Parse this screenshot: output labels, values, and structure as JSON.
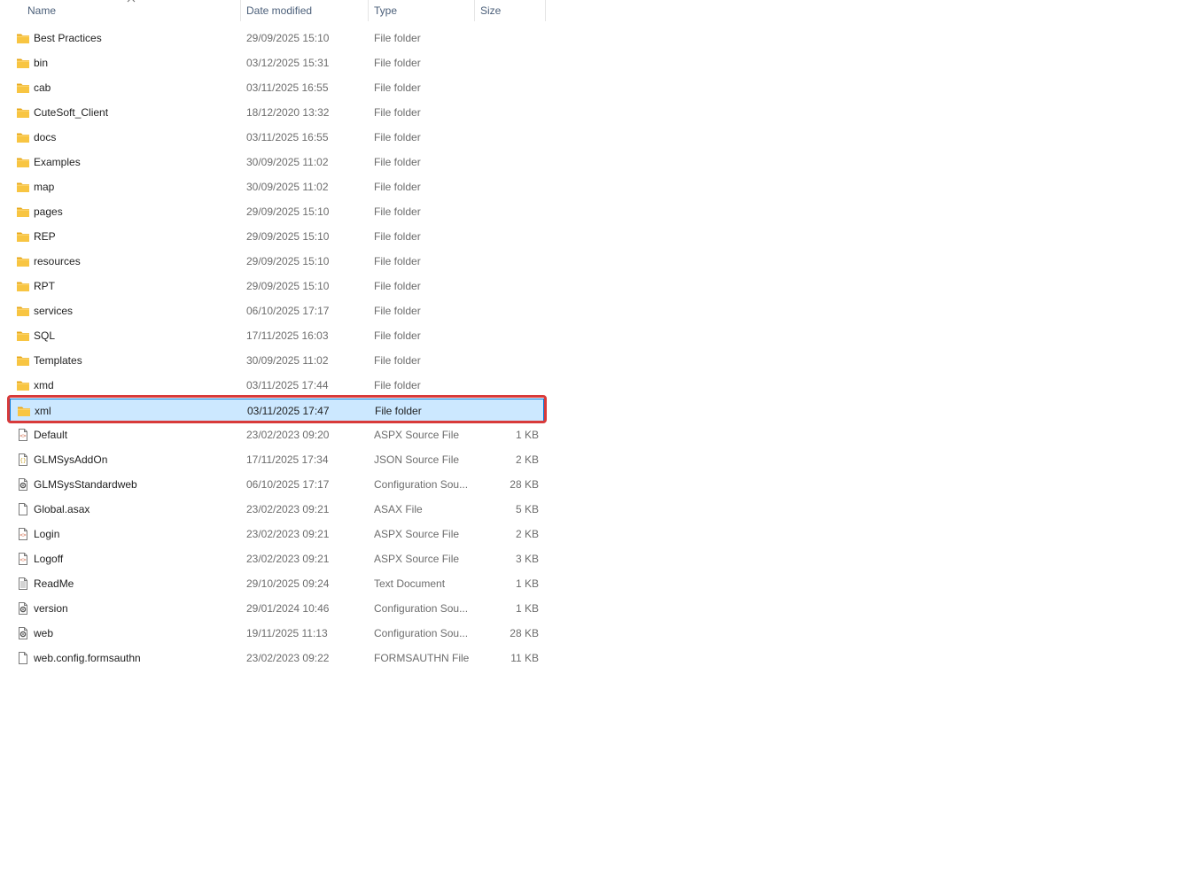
{
  "columns": {
    "name": "Name",
    "date_modified": "Date modified",
    "type": "Type",
    "size": "Size"
  },
  "sort": {
    "column": "name",
    "direction": "ascending"
  },
  "rows": [
    {
      "name": "Best Practices",
      "date": "29/09/2025 15:10",
      "type": "File folder",
      "size": "",
      "icon": "folder-icon"
    },
    {
      "name": "bin",
      "date": "03/12/2025 15:31",
      "type": "File folder",
      "size": "",
      "icon": "folder-icon"
    },
    {
      "name": "cab",
      "date": "03/11/2025 16:55",
      "type": "File folder",
      "size": "",
      "icon": "folder-icon"
    },
    {
      "name": "CuteSoft_Client",
      "date": "18/12/2020 13:32",
      "type": "File folder",
      "size": "",
      "icon": "folder-icon"
    },
    {
      "name": "docs",
      "date": "03/11/2025 16:55",
      "type": "File folder",
      "size": "",
      "icon": "folder-icon"
    },
    {
      "name": "Examples",
      "date": "30/09/2025 11:02",
      "type": "File folder",
      "size": "",
      "icon": "folder-icon"
    },
    {
      "name": "map",
      "date": "30/09/2025 11:02",
      "type": "File folder",
      "size": "",
      "icon": "folder-icon"
    },
    {
      "name": "pages",
      "date": "29/09/2025 15:10",
      "type": "File folder",
      "size": "",
      "icon": "folder-icon"
    },
    {
      "name": "REP",
      "date": "29/09/2025 15:10",
      "type": "File folder",
      "size": "",
      "icon": "folder-icon"
    },
    {
      "name": "resources",
      "date": "29/09/2025 15:10",
      "type": "File folder",
      "size": "",
      "icon": "folder-icon"
    },
    {
      "name": "RPT",
      "date": "29/09/2025 15:10",
      "type": "File folder",
      "size": "",
      "icon": "folder-icon"
    },
    {
      "name": "services",
      "date": "06/10/2025 17:17",
      "type": "File folder",
      "size": "",
      "icon": "folder-icon"
    },
    {
      "name": "SQL",
      "date": "17/11/2025 16:03",
      "type": "File folder",
      "size": "",
      "icon": "folder-icon"
    },
    {
      "name": "Templates",
      "date": "30/09/2025 11:02",
      "type": "File folder",
      "size": "",
      "icon": "folder-icon"
    },
    {
      "name": "xmd",
      "date": "03/11/2025 17:44",
      "type": "File folder",
      "size": "",
      "icon": "folder-icon"
    },
    {
      "name": "xml",
      "date": "03/11/2025 17:47",
      "type": "File folder",
      "size": "",
      "icon": "folder-icon",
      "selected": true
    },
    {
      "name": "Default",
      "date": "23/02/2023 09:20",
      "type": "ASPX Source File",
      "size": "1 KB",
      "icon": "aspx-file-icon"
    },
    {
      "name": "GLMSysAddOn",
      "date": "17/11/2025 17:34",
      "type": "JSON Source File",
      "size": "2 KB",
      "icon": "json-file-icon"
    },
    {
      "name": "GLMSysStandardweb",
      "date": "06/10/2025 17:17",
      "type": "Configuration Sou...",
      "size": "28 KB",
      "icon": "config-file-icon"
    },
    {
      "name": "Global.asax",
      "date": "23/02/2023 09:21",
      "type": "ASAX File",
      "size": "5 KB",
      "icon": "blank-file-icon"
    },
    {
      "name": "Login",
      "date": "23/02/2023 09:21",
      "type": "ASPX Source File",
      "size": "2 KB",
      "icon": "aspx-file-icon"
    },
    {
      "name": "Logoff",
      "date": "23/02/2023 09:21",
      "type": "ASPX Source File",
      "size": "3 KB",
      "icon": "aspx-file-icon"
    },
    {
      "name": "ReadMe",
      "date": "29/10/2025 09:24",
      "type": "Text Document",
      "size": "1 KB",
      "icon": "text-file-icon"
    },
    {
      "name": "version",
      "date": "29/01/2024 10:46",
      "type": "Configuration Sou...",
      "size": "1 KB",
      "icon": "config-file-icon"
    },
    {
      "name": "web",
      "date": "19/11/2025 11:13",
      "type": "Configuration Sou...",
      "size": "28 KB",
      "icon": "config-file-icon"
    },
    {
      "name": "web.config.formsauthn",
      "date": "23/02/2023 09:22",
      "type": "FORMSAUTHN File",
      "size": "11 KB",
      "icon": "blank-file-icon"
    }
  ],
  "colors": {
    "header_text": "#4c607a",
    "selection_fill": "#cce8ff",
    "selection_border": "#0078d7",
    "highlight_outline": "#d83a3a",
    "folder": "#f8c542"
  }
}
